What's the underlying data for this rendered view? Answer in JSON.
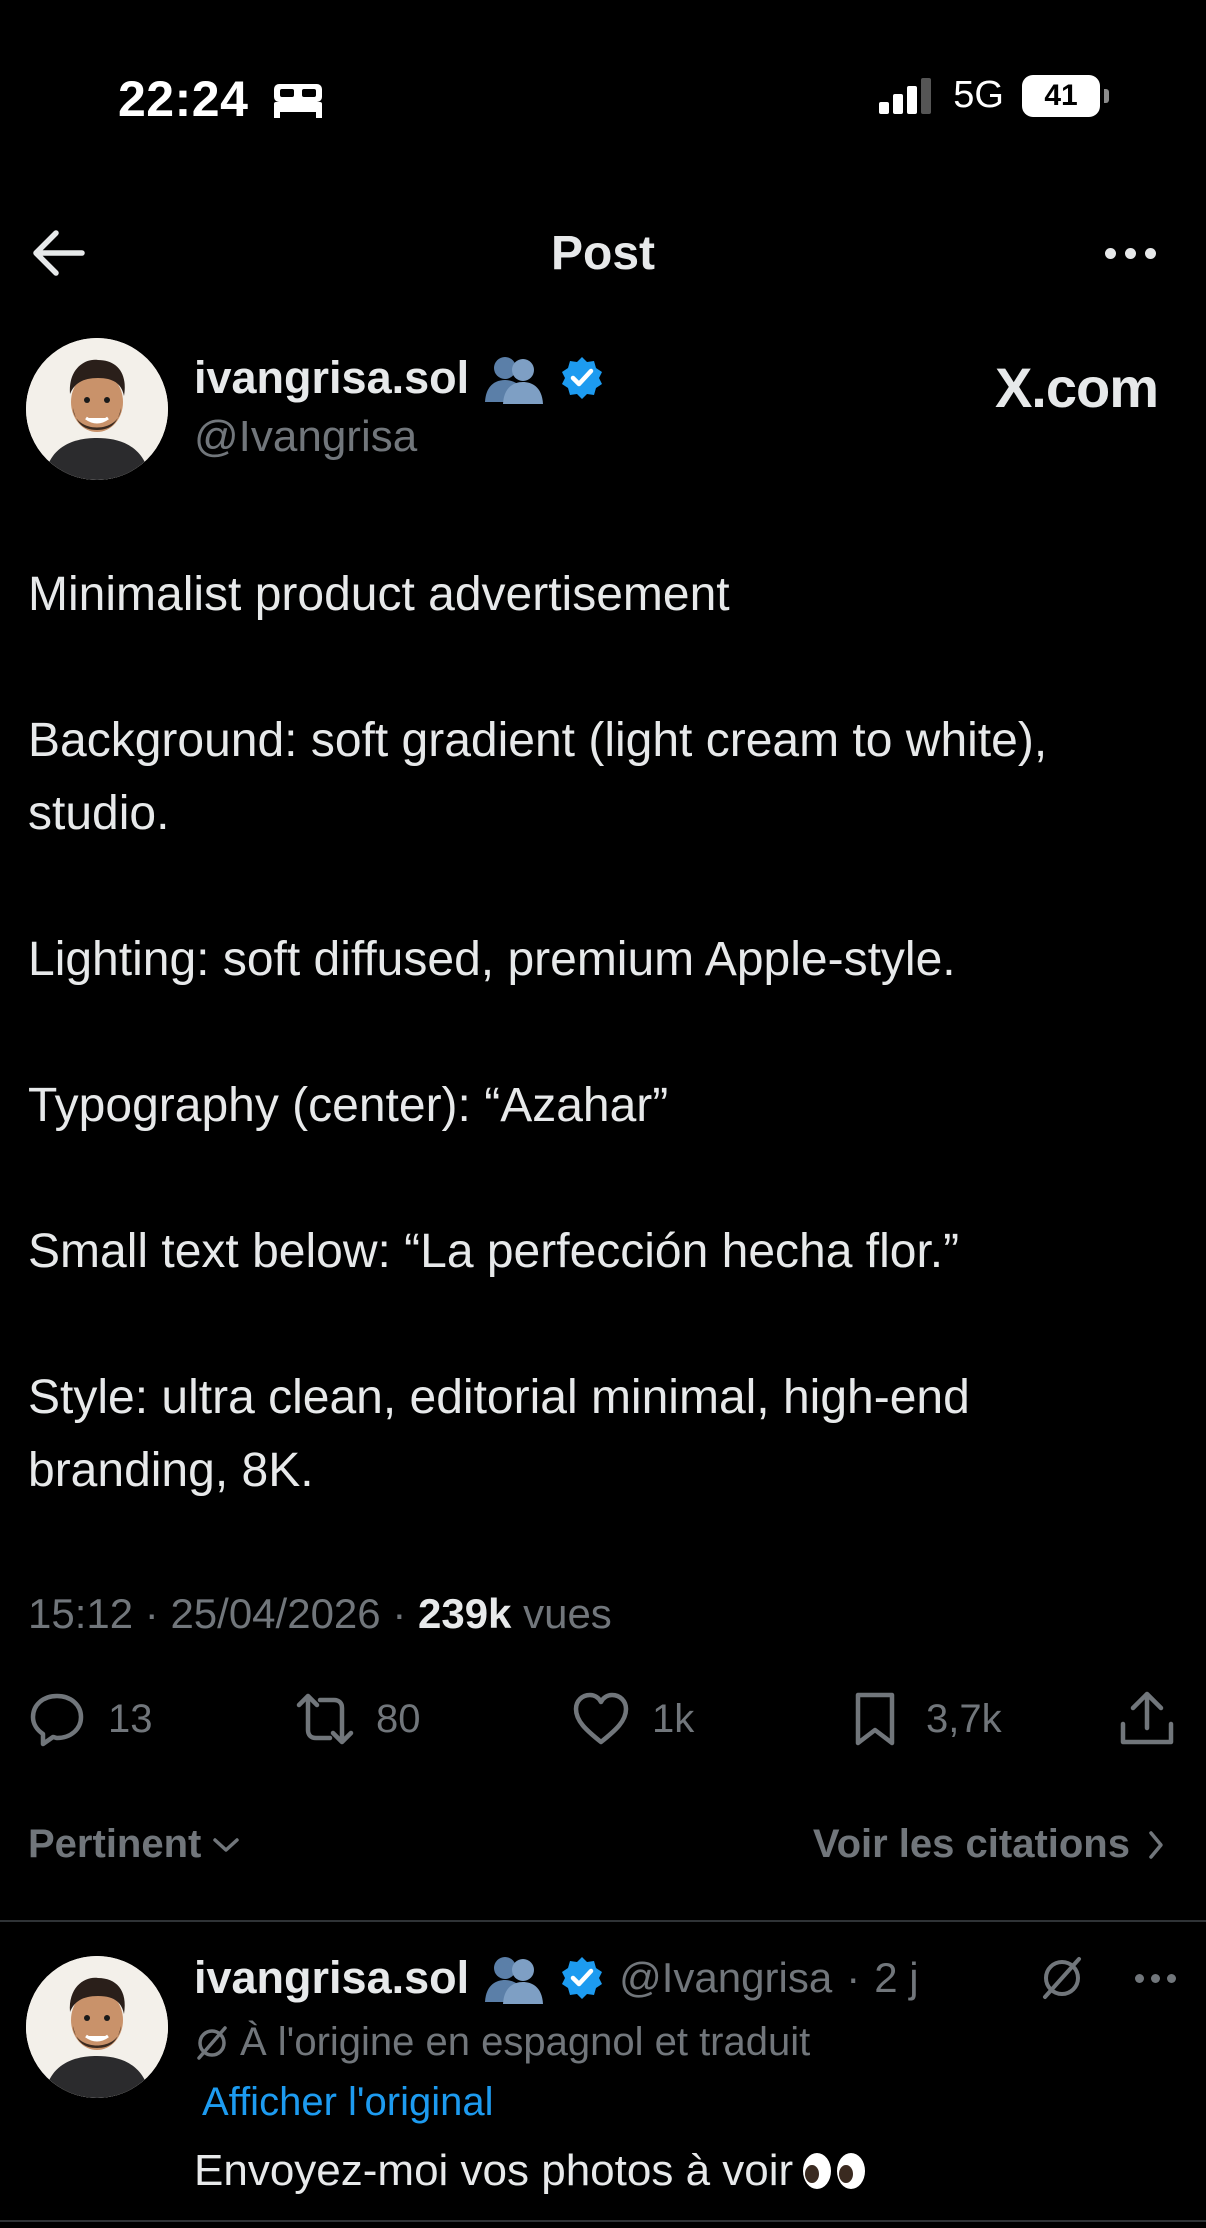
{
  "status_bar": {
    "time": "22:24",
    "network": "5G",
    "battery": "41"
  },
  "header": {
    "title": "Post"
  },
  "author": {
    "name": "ivangrisa.sol",
    "handle": "@Ivangrisa",
    "watermark": "X.com"
  },
  "post": {
    "paragraphs": [
      "Minimalist product advertisement",
      "Background: soft gradient (light cream to white), studio.",
      "Lighting: soft diffused, premium Apple-style.",
      "Typography (center): “Azahar”",
      "Small text below: “La perfección hecha flor.”",
      "Style: ultra clean, editorial minimal, high-end branding, 8K."
    ],
    "time": "15:12",
    "date": "25/04/2026",
    "views_count": "239k",
    "views_label": "vues"
  },
  "actions": {
    "replies": "13",
    "reposts": "80",
    "likes": "1k",
    "bookmarks": "3,7k"
  },
  "sort": {
    "label": "Pertinent",
    "quotes_link": "Voir les citations"
  },
  "reply": {
    "name": "ivangrisa.sol",
    "handle": "@Ivangrisa",
    "age": "2 j",
    "translated_note": "À l'origine en espagnol et traduit",
    "show_original": "Afficher l'original",
    "text": "Envoyez-moi vos photos à voir"
  },
  "colors": {
    "accent": "#1d9bf0",
    "muted": "#71767b",
    "text": "#e7e9ea",
    "background": "#000000"
  }
}
